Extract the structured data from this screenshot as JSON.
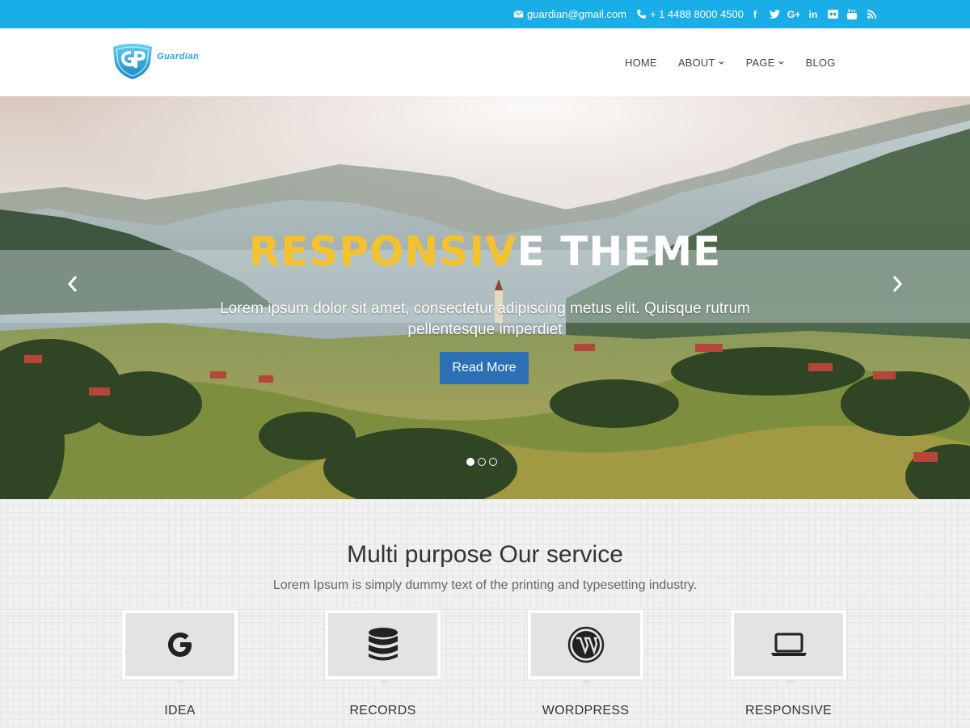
{
  "topbar": {
    "email": "guardian@gmail.com",
    "phone": "+ 1 4488 8000 4500",
    "socials": [
      "facebook-icon",
      "twitter-icon",
      "google-plus-icon",
      "linkedin-icon",
      "flickr-icon",
      "youtube-icon",
      "rss-icon"
    ],
    "bg_color": "#1aaee8"
  },
  "header": {
    "logo_text": "Guardian",
    "nav": [
      {
        "label": "HOME",
        "has_caret": false
      },
      {
        "label": "ABOUT",
        "has_caret": true
      },
      {
        "label": "PAGE",
        "has_caret": true
      },
      {
        "label": "BLOG",
        "has_caret": false
      }
    ]
  },
  "hero": {
    "title_accent": "RESPONSIV",
    "title_rest": "E THEME",
    "text": "Lorem ipsum dolor sit amet, consectetur adipiscing metus elit. Quisque rutrum pellentesque imperdiet",
    "button_label": "Read More",
    "slides": 3,
    "active_slide": 1,
    "accent_color": "#f5c22e",
    "button_color": "#2c6fb5"
  },
  "services": {
    "title": "Multi purpose Our service",
    "subtitle": "Lorem Ipsum is simply dummy text of the printing and typesetting industry.",
    "items": [
      {
        "label": "IDEA",
        "icon": "google-icon"
      },
      {
        "label": "RECORDS",
        "icon": "database-icon"
      },
      {
        "label": "WORDPRESS",
        "icon": "wordpress-icon"
      },
      {
        "label": "RESPONSIVE",
        "icon": "laptop-icon"
      }
    ]
  }
}
